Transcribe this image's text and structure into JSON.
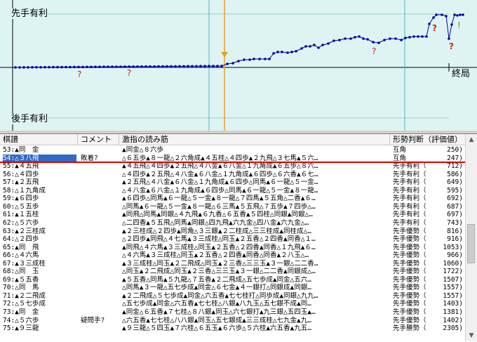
{
  "graph": {
    "top_label": "先手有利",
    "bottom_label": "後手有利",
    "end_label": "終局",
    "question_marks": [
      "?",
      "?",
      "?",
      "?",
      "?"
    ],
    "colors": {
      "background": "#ddf4f2",
      "line": "#0000aa",
      "marker": "#e8a020",
      "mistake": "#cc2020",
      "good": "#20a040"
    }
  },
  "table": {
    "headers": {
      "move": "棋譜",
      "comment": "コメント",
      "line": "激指の読み筋",
      "judge": "形勢判断（評価値）"
    },
    "rows": [
      {
        "move": "53:▲同　金",
        "comment": "",
        "line": "▲同金△８六歩",
        "judge": "互角",
        "val": "250)"
      },
      {
        "move": "54:△３八飛",
        "comment": "敗着?",
        "line": "△６五歩▲８一龍△２六角成▲４五桂△４四歩▲２九飛△３七馬▲５六…",
        "judge": "互角",
        "val": "247)"
      },
      {
        "move": "55:▲４五飛",
        "comment": "",
        "line": "▲４五飛△４四歩▲２五飛△４八金▲６八金△１九角成▲６五歩△８六…",
        "judge": "先手有利（",
        "val": "712)"
      },
      {
        "move": "56:△４四歩",
        "comment": "",
        "line": "△４四歩▲２五飛△４八金▲６八金△１九角成▲６四歩△６六香▲６七…",
        "judge": "先手有利（",
        "val": "586)"
      },
      {
        "move": "57:▲２五飛",
        "comment": "",
        "line": "▲２五飛△４八金▲６八金△１九角成▲６四歩△同馬▲６一龍△５一金…",
        "judge": "先手有利（",
        "val": "649)"
      },
      {
        "move": "58:△１九角成",
        "comment": "",
        "line": "△４八金▲６八金△１九角成▲６四歩△同馬▲６一龍△５一金▲８一龍…",
        "judge": "先手有利（",
        "val": "595)"
      },
      {
        "move": "59:▲６四歩",
        "comment": "",
        "line": "▲６四歩△同馬▲６一龍△５一金▲８一龍△７四馬▲５五角△二香▲６…",
        "judge": "先手有利（",
        "val": "692)"
      },
      {
        "move": "60:△５五歩",
        "comment": "",
        "line": "△同馬▲６一龍△５一金▲８一龍△６三馬▲５五飛△７五歩▲７四歩△…",
        "judge": "先手有利（",
        "val": "687)"
      },
      {
        "move": "61:▲１五桂",
        "comment": "",
        "line": "▲同飛△同馬▲同銀△４九飛▲６九香△６五香▲５四桂△同銀▲同銀△…",
        "judge": "先手有利（",
        "val": "697)"
      },
      {
        "move": "62:△５六歩",
        "comment": "",
        "line": "△二四香▲５五飛△同馬▲同銀△四九飛▲六九金△四八金▲六九金△…",
        "judge": "先手有利（",
        "val": "743)"
      },
      {
        "move": "63:▲２三桂成",
        "comment": "",
        "line": "▲２三桂成△２四歩▲同角△３三銀▲２二桂成△三三桂成▲同桂成△…",
        "judge": "先手優勢（",
        "val": "816)"
      },
      {
        "move": "64:△２四歩",
        "comment": "",
        "line": "△２四歩▲同飛△４七馬▲３三成桂△同玉▲２五香△２四香▲同香△１…",
        "judge": "先手優勢（",
        "val": "916)"
      },
      {
        "move": "65:▲同　飛",
        "comment": "",
        "line": "▲同飛△４六馬▲３三成桂△同玉▲２五香△２四香▲同香△１九飛▲６…",
        "judge": "先手優勢（",
        "val": "1053)"
      },
      {
        "move": "66:△４六馬",
        "comment": "",
        "line": "△４六馬▲３三成桂△同玉▲２五香△２四香▲同香△同香▲２八玉△…",
        "judge": "先手優勢（",
        "val": "966)"
      },
      {
        "move": "67:▲３三成桂",
        "comment": "",
        "line": "▲３三成桂△同玉▲２二飛成△同玉▲２三香△三三玉▲３一銀△二二香…",
        "judge": "先手優勢（",
        "val": "1060)"
      },
      {
        "move": "68:△同　玉",
        "comment": "",
        "line": "△同玉▲２二飛成△同玉▲２三香△三三玉▲３一銀△二二香▲同銀成△…",
        "judge": "先手優勢（",
        "val": "1722)"
      },
      {
        "move": "69:▲５五香",
        "comment": "",
        "line": "▲５五香△同馬▲５九龍△７五香▲２二飛成△五七歩成▲同金△五六…",
        "judge": "先手優勢（",
        "val": "1507)"
      },
      {
        "move": "70:△同　馬",
        "comment": "",
        "line": "△同馬▲３一龍△五七歩成▲同金△６七金▲４一銀打△同銀成▲同銀…",
        "judge": "先手優勢（",
        "val": "1557)"
      },
      {
        "move": "71:▲２二飛成",
        "comment": "",
        "line": "▲２二飛成△５七歩成▲同金△六五香▲七七桂打△同歩成▲同銀△九九…",
        "judge": "先手優勢（",
        "val": "1557)"
      },
      {
        "move": "72:△５七歩成",
        "comment": "",
        "line": "△五七歩成▲同金△六五香▲七七桂△八銀▲八九玉△五七銀不成▲同…",
        "judge": "先手優勢（",
        "val": "1403)"
      },
      {
        "move": "73:▲同　金",
        "comment": "",
        "line": "▲同金△６五香▲７七桂△８八銀▲同玉△六七銀打▲九三銀△五四玉▲…",
        "judge": "先手優勢（",
        "val": "1381)"
      },
      {
        "move": "74:△５六歩",
        "comment": "疑問手?",
        "line": "△六五香▲七七桂△八八銀▲同玉△五七銀成▲三三成桂△七九金▲九…",
        "judge": "先手優勢（",
        "val": "1402)"
      },
      {
        "move": "75:▲９三龍",
        "comment": "",
        "line": "▲９三龍△５四玉▲７六桂△６五玉▲６六歩△５六桂▲六五香▲九五…",
        "judge": "先手勝勢（",
        "val": "2305)"
      }
    ],
    "selected_row": 1
  }
}
